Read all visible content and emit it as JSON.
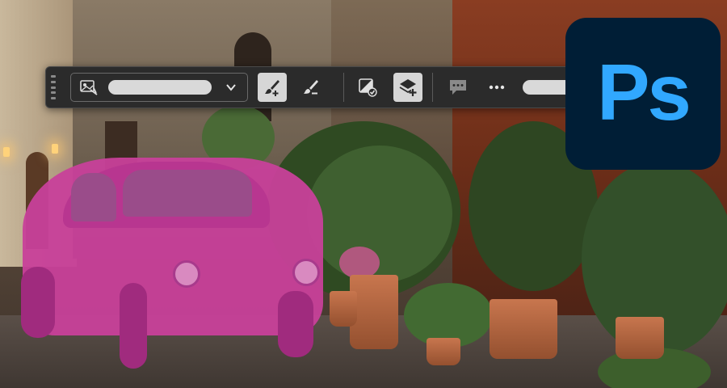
{
  "app": {
    "logo_text": "Ps",
    "logo_bg_color": "#001e36",
    "logo_fg_color": "#31a8ff"
  },
  "toolbar": {
    "grip_icon": "drag-handle-icon",
    "selection_mode": {
      "icon": "object-selection-icon",
      "dropdown_icon": "chevron-down-icon"
    },
    "buttons": [
      {
        "icon": "brush-add-icon",
        "active": true
      },
      {
        "icon": "brush-subtract-icon",
        "active": false
      },
      {
        "icon": "mask-check-icon",
        "active": false
      },
      {
        "icon": "layer-mask-add-icon",
        "active": true
      },
      {
        "icon": "comment-icon",
        "active": false
      },
      {
        "icon": "more-options-icon",
        "active": false
      }
    ]
  },
  "canvas": {
    "mask_color": "#c8409a"
  }
}
